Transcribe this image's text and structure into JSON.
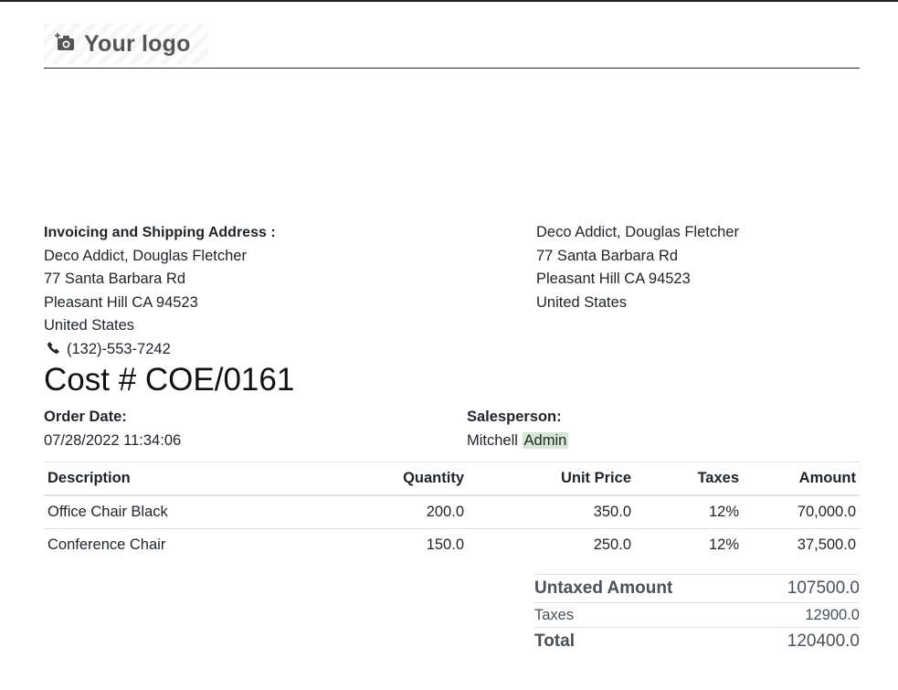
{
  "header": {
    "logo_text": "Your logo",
    "logo_icon": "camera-plus-icon"
  },
  "invoicing_address": {
    "heading": "Invoicing and Shipping Address :",
    "lines": [
      "Deco Addict, Douglas Fletcher",
      "77 Santa Barbara Rd",
      "Pleasant Hill CA 94523",
      "United States"
    ],
    "phone": "(132)-553-7242",
    "phone_icon": "phone-icon"
  },
  "partner_address": {
    "lines": [
      "Deco Addict, Douglas Fletcher",
      "77 Santa Barbara Rd",
      "Pleasant Hill CA 94523",
      "United States"
    ]
  },
  "document": {
    "title": "Cost # COE/0161"
  },
  "info": {
    "order_date_label": "Order Date:",
    "order_date_value": "07/28/2022 11:34:06",
    "salesperson_label": "Salesperson:",
    "salesperson_first": "Mitchell",
    "salesperson_last": "Admin"
  },
  "lines_table": {
    "headers": [
      "Description",
      "Quantity",
      "Unit Price",
      "Taxes",
      "Amount"
    ],
    "rows": [
      [
        "Office Chair Black",
        "200.0",
        "350.0",
        "12%",
        "70,000.0"
      ],
      [
        "Conference Chair",
        "150.0",
        "250.0",
        "12%",
        "37,500.0"
      ]
    ]
  },
  "totals": {
    "untaxed_label": "Untaxed Amount",
    "untaxed_value": "107500.0",
    "taxes_label": "Taxes",
    "taxes_value": "12900.0",
    "total_label": "Total",
    "total_value": "120400.0"
  },
  "colors": {
    "highlight": "#d6e7d4",
    "text": "#212529",
    "rule": "#dee2e6"
  }
}
